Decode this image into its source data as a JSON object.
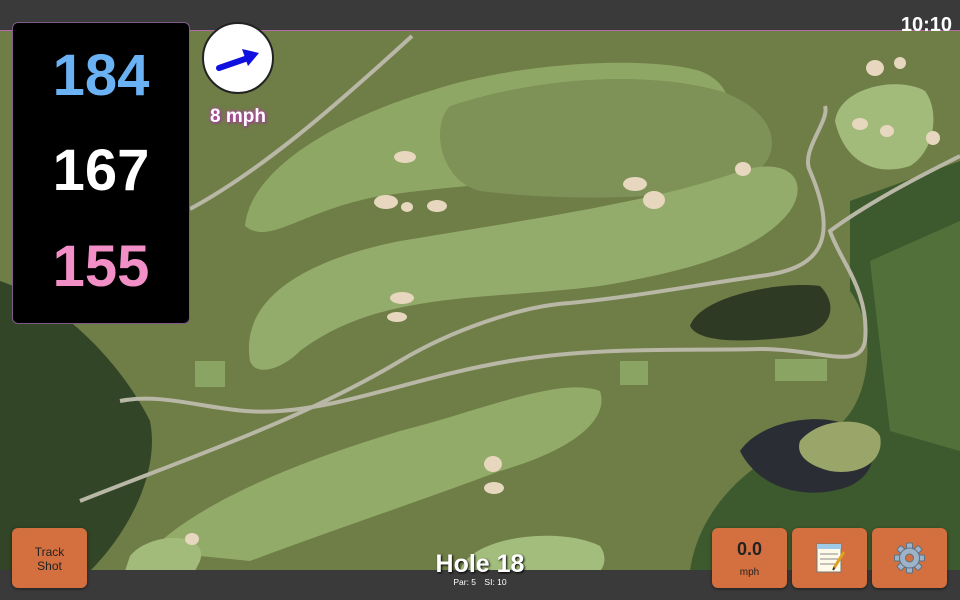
{
  "status": {
    "clock": "10:10"
  },
  "distances": {
    "back": "184",
    "middle": "167",
    "front": "155",
    "back_color": "#6ab2f4",
    "middle_color": "#ffffff",
    "front_color": "#f28fc7"
  },
  "wind": {
    "speed_label": "8 mph",
    "direction_icon": "arrow-icon",
    "arrow_color": "#1010e0"
  },
  "buttons": {
    "track_shot_line1": "Track",
    "track_shot_line2": "Shot",
    "wind_value": "0.0",
    "wind_unit": "mph",
    "notes_icon": "notepad-icon",
    "settings_icon": "gear-icon",
    "color": "#d4703f"
  },
  "hole": {
    "title": "Hole 18",
    "par": "Par: 5",
    "si": "SI: 10"
  }
}
